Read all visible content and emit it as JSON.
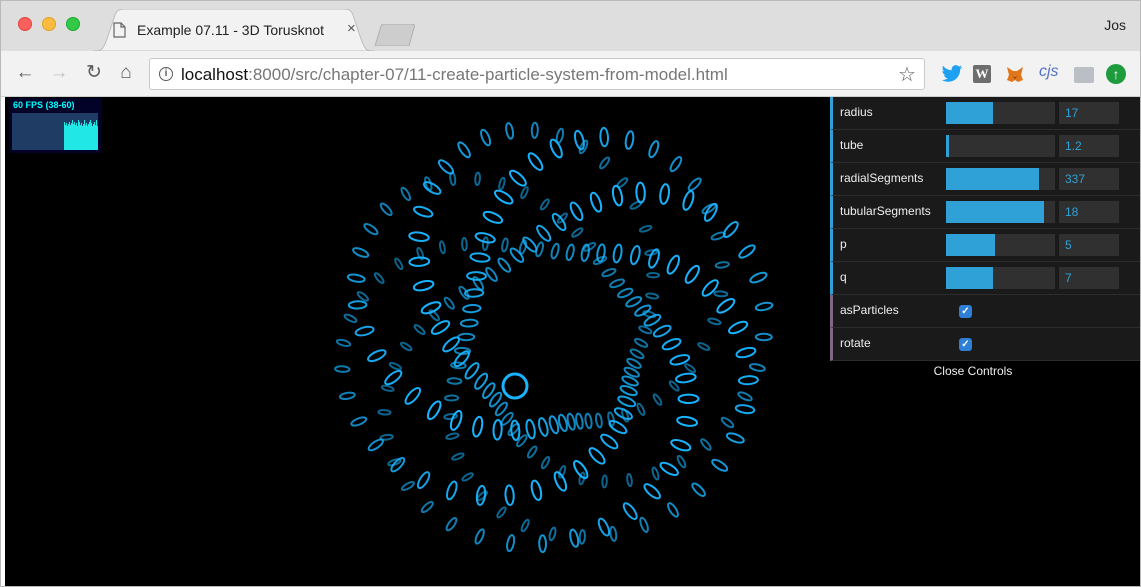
{
  "browser": {
    "tab_title": "Example 07.11 - 3D Torusknot",
    "tab_close": "×",
    "profile_name": "Jos",
    "url_host": "localhost",
    "url_rest": ":8000/src/chapter-07/11-create-particle-system-from-model.html",
    "extensions": {
      "w_label": "W",
      "cjs_label": "cjs"
    }
  },
  "stats": {
    "fps_text": "60 FPS (38-60)",
    "color": "#00ffff"
  },
  "controls": {
    "accent_color": "#2fa1d6",
    "rows": [
      {
        "label": "radius",
        "value": "17",
        "fill": 0.43
      },
      {
        "label": "tube",
        "value": "1.2",
        "fill": 0.03
      },
      {
        "label": "radialSegments",
        "value": "337",
        "fill": 0.85
      },
      {
        "label": "tubularSegments",
        "value": "18",
        "fill": 0.9
      },
      {
        "label": "p",
        "value": "5",
        "fill": 0.45
      },
      {
        "label": "q",
        "value": "7",
        "fill": 0.43
      }
    ],
    "toggles": [
      {
        "label": "asParticles",
        "checked": true
      },
      {
        "label": "rotate",
        "checked": true
      }
    ],
    "close_label": "Close Controls"
  },
  "scene": {
    "particle_color": "#18b4ff"
  }
}
